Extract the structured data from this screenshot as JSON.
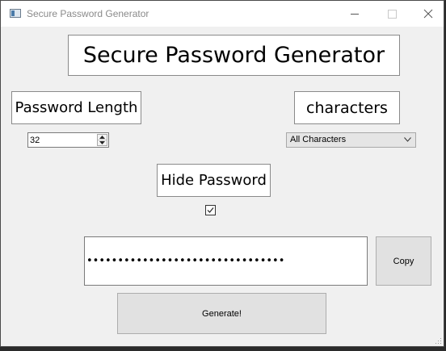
{
  "window": {
    "title": "Secure Password Generator",
    "icon": "app-window-icon",
    "controls": [
      "minimize-icon",
      "maximize-icon",
      "close-icon"
    ]
  },
  "main": {
    "title": "Secure Password Generator",
    "password_length": {
      "label": "Password Length",
      "value": "32"
    },
    "characters": {
      "label": "characters",
      "selected": "All Characters"
    },
    "hide_password": {
      "label": "Hide Password",
      "checked": true
    },
    "password": {
      "masked_value": "••••••••••••••••••••••••••••••••"
    },
    "copy_label": "Copy",
    "generate_label": "Generate!"
  },
  "colors": {
    "window_bg": "#f0f0f0",
    "button_bg": "#e1e1e1",
    "label_bg": "#ffffff"
  }
}
